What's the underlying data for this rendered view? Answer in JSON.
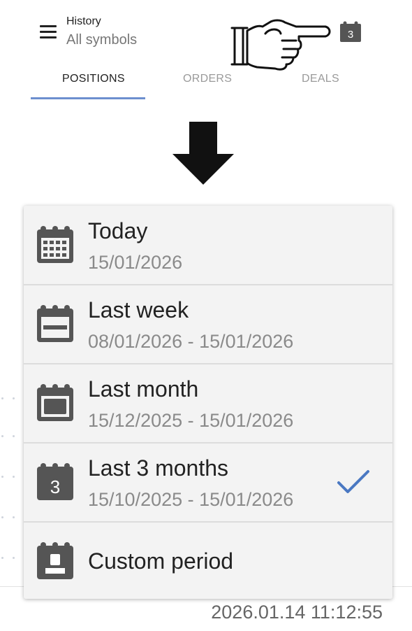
{
  "header": {
    "title_small": "History",
    "title_big": "All symbols",
    "calendar_badge": "3"
  },
  "tabs": [
    {
      "label": "POSITIONS",
      "active": true
    },
    {
      "label": "ORDERS",
      "active": false
    },
    {
      "label": "DEALS",
      "active": false
    }
  ],
  "period_menu": {
    "items": [
      {
        "label": "Today",
        "range": "15/01/2026",
        "icon": "calendar-days-icon",
        "selected": false
      },
      {
        "label": "Last week",
        "range": "08/01/2026 - 15/01/2026",
        "icon": "calendar-week-icon",
        "selected": false
      },
      {
        "label": "Last month",
        "range": "15/12/2025 - 15/01/2026",
        "icon": "calendar-month-icon",
        "selected": false
      },
      {
        "label": "Last 3 months",
        "range": "15/10/2025 - 15/01/2026",
        "icon": "calendar-3-icon",
        "icon_text": "3",
        "selected": true
      },
      {
        "label": "Custom period",
        "range": "",
        "icon": "calendar-custom-icon",
        "selected": false
      }
    ]
  },
  "footer": {
    "timestamp": "2026.01.14 11:12:55"
  },
  "colors": {
    "accent": "#6d8fcf",
    "check": "#4a78c2",
    "icon": "#555555"
  }
}
